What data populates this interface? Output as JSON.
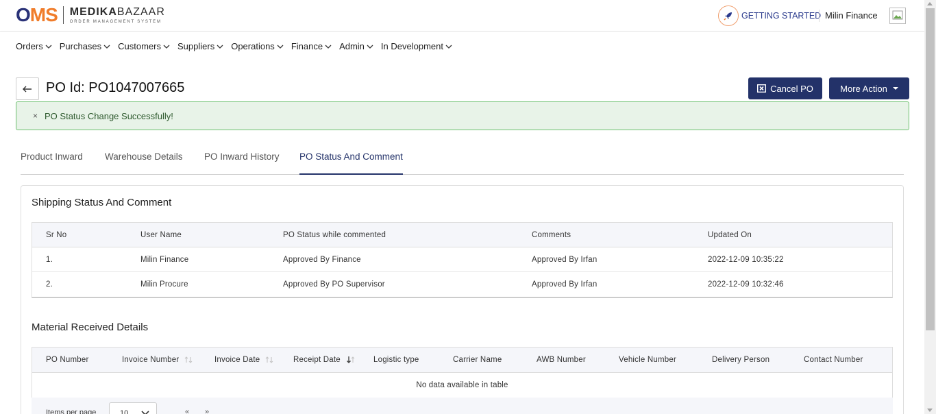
{
  "header": {
    "logo_oms_o": "O",
    "logo_oms_ms": "MS",
    "brand_bold": "MEDIKA",
    "brand_thin": "BAZAAR",
    "brand_sub": "ORDER MANAGEMENT SYSTEM",
    "getting_started": "GETTING STARTED",
    "user_name": "Milin Finance"
  },
  "nav": {
    "items": [
      {
        "label": "Orders"
      },
      {
        "label": "Purchases"
      },
      {
        "label": "Customers"
      },
      {
        "label": "Suppliers"
      },
      {
        "label": "Operations"
      },
      {
        "label": "Finance"
      },
      {
        "label": "Admin"
      },
      {
        "label": "In Development"
      }
    ]
  },
  "page": {
    "title": "PO Id: PO1047007665",
    "cancel_label": "Cancel PO",
    "more_label": "More Action",
    "alert_close": "×",
    "alert_text": "PO Status Change Successfully!"
  },
  "tabs": [
    {
      "label": "Product Inward"
    },
    {
      "label": "Warehouse Details"
    },
    {
      "label": "PO Inward History"
    },
    {
      "label": "PO Status And Comment"
    }
  ],
  "active_tab": "PO Status And Comment",
  "shipping": {
    "title": "Shipping Status And Comment",
    "columns": [
      "Sr No",
      "User Name",
      "PO Status while commented",
      "Comments",
      "Updated On"
    ],
    "rows": [
      [
        "1.",
        "Milin Finance",
        "Approved By Finance",
        "Approved By Irfan",
        "2022-12-09 10:35:22"
      ],
      [
        "2.",
        "Milin Procure",
        "Approved By PO Supervisor",
        "Approved By Irfan",
        "2022-12-09 10:32:46"
      ]
    ]
  },
  "material": {
    "title": "Material Received Details",
    "columns": [
      "PO Number",
      "Invoice Number",
      "Invoice Date",
      "Receipt Date",
      "Logistic type",
      "Carrier Name",
      "AWB Number",
      "Vehicle Number",
      "Delivery Person",
      "Contact Number"
    ],
    "empty_text": "No data available in table",
    "items_per_page_label": "Items per page",
    "items_per_page": "10",
    "prev": "«",
    "next": "»"
  },
  "colors": {
    "primary": "#233269",
    "accent_orange": "#f07c2a",
    "alert_bg": "#e8f3e8",
    "alert_border": "#6cbf6e"
  }
}
